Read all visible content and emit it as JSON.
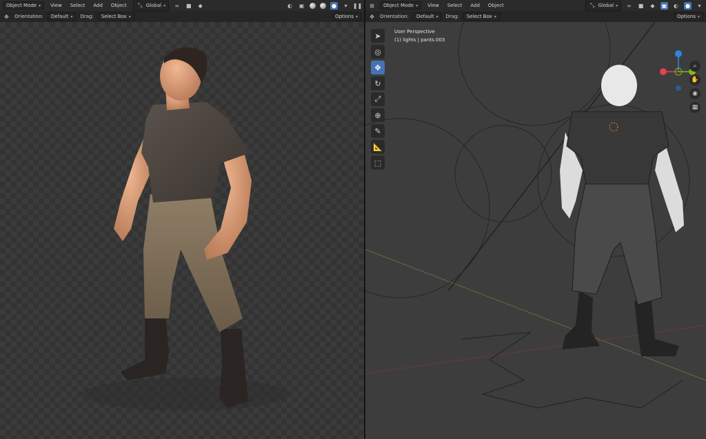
{
  "left_header": {
    "mode": "Object Mode",
    "menus": [
      "View",
      "Select",
      "Add",
      "Object"
    ],
    "transform": "Global",
    "options": "Options"
  },
  "left_toolrow": {
    "orientation_label": "Orientation:",
    "orientation_value": "Default",
    "drag_label": "Drag:",
    "drag_value": "Select Box"
  },
  "right_header": {
    "mode": "Object Mode",
    "menus": [
      "View",
      "Select",
      "Add",
      "Object"
    ],
    "transform": "Global",
    "options": "Options"
  },
  "right_toolrow": {
    "orientation_label": "Orientation:",
    "orientation_value": "Default",
    "drag_label": "Drag:",
    "drag_value": "Select Box"
  },
  "right_viewport": {
    "view_name": "User Perspective",
    "collection": "(1) lights | pants.003"
  },
  "colors": {
    "accent": "#4772b3",
    "axis_x": "#e2424f",
    "axis_y": "#83b81d",
    "axis_z": "#2e86de"
  },
  "icons": [
    "move-icon",
    "cursor-icon",
    "rotate-icon",
    "scale-icon",
    "transform-icon",
    "annotate-icon",
    "measure-icon",
    "add-cube-icon",
    "zoom-icon",
    "hand-icon",
    "camera-icon",
    "grid-icon"
  ]
}
